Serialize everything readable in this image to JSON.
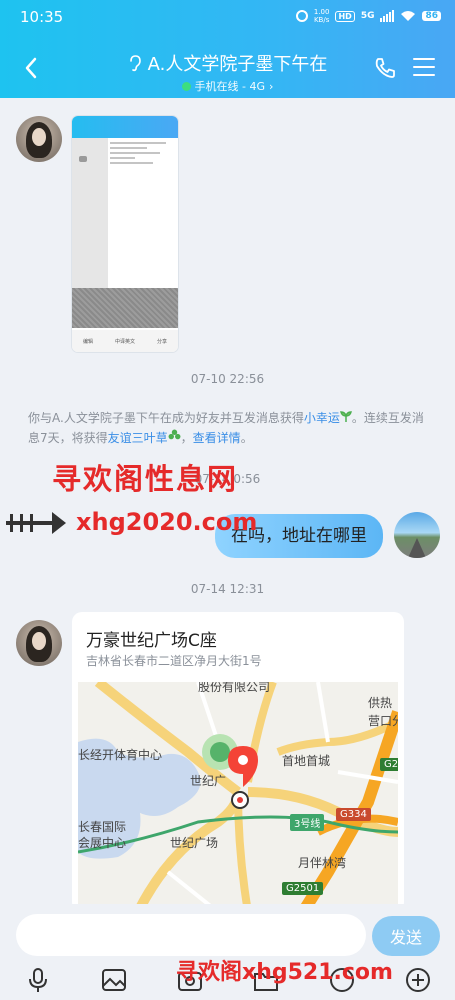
{
  "status_bar": {
    "time": "10:35",
    "speed_value": "1.00",
    "speed_unit": "KB/s",
    "hd": "HD",
    "network": "5G",
    "battery": "86"
  },
  "header": {
    "title": "A.人文学院子墨下午在",
    "status": "手机在线 - 4G",
    "status_arrow": "›",
    "back_icon": "chevron-left-icon",
    "call_icon": "phone-icon",
    "menu_icon": "menu-icon"
  },
  "screenshot_msg": {
    "buttons": [
      "编辑",
      "中译英文",
      "分享"
    ]
  },
  "timestamps": [
    "07-10 22:56",
    "07-14 0:56",
    "07-14 12:31"
  ],
  "system_message": {
    "part1": "你与A.人文学院子墨下午在成为好友并互发消息获得",
    "link1": "小幸运",
    "part2": "。连续互发消息7天，将获得",
    "link2": "友谊三叶草",
    "part3": "，",
    "link3": "查看详情",
    "part4": "。"
  },
  "watermarks": {
    "top": "寻欢阁性息网",
    "middle": "xhg2020.com",
    "bottom": "寻欢阁xhg521.com"
  },
  "my_message": {
    "text": "在吗，地址在哪里"
  },
  "location": {
    "title": "万豪世纪广场C座",
    "address": "吉林省长春市二道区净月大街1号",
    "map_labels": {
      "top": "股份有限公司",
      "topright1": "供热",
      "topright2": "营口分",
      "sports": "长经开体育中心",
      "shoudi": "首地首城",
      "shiji_short": "世纪广",
      "exhibit1": "长春国际",
      "exhibit2": "会展中心",
      "shiji": "世纪广场",
      "line3": "3号线",
      "linwan": "月伴林湾",
      "g334": "G334",
      "g2501": "G2501",
      "g2": "G2"
    }
  },
  "input_bar": {
    "placeholder": "",
    "send_label": "发送",
    "tools": [
      "microphone-icon",
      "image-icon",
      "camera-icon",
      "folder-icon",
      "emoji-icon",
      "plus-icon"
    ]
  },
  "colors": {
    "header_start": "#1ec3f0",
    "header_end": "#49a7f4",
    "link": "#3a8ee6",
    "watermark": "#e52a2a",
    "send_button": "#8ecbf3"
  }
}
